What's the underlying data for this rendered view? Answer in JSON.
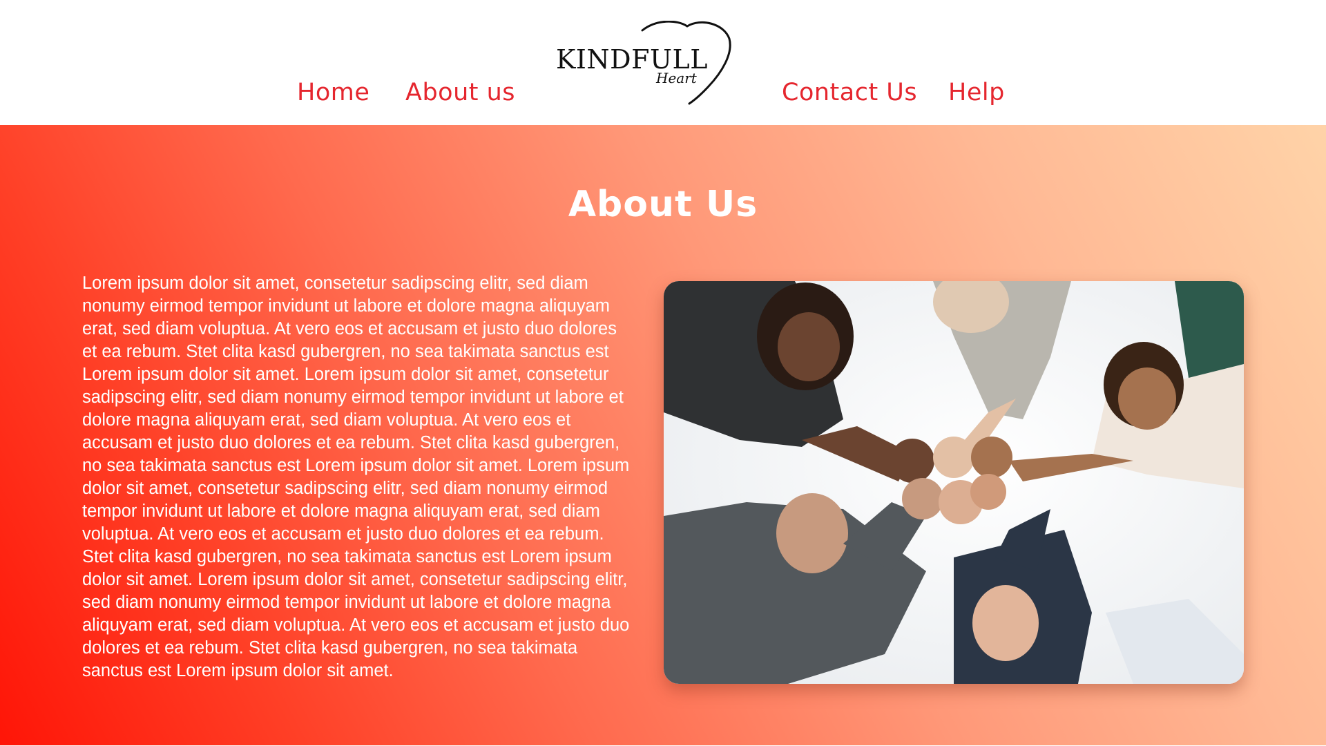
{
  "nav": {
    "home": "Home",
    "about": "About us",
    "contact": "Contact Us",
    "help": "Help"
  },
  "logo": {
    "main": "KINDFULL",
    "sub": "Heart",
    "icon": "heart-outline-icon"
  },
  "hero": {
    "title": "About Us",
    "body": "Lorem ipsum dolor sit amet, consetetur sadipscing elitr, sed diam nonumy eirmod tempor invidunt ut labore et dolore magna aliquyam erat, sed diam voluptua. At vero eos et accusam et justo duo dolores et ea rebum. Stet clita kasd gubergren, no sea takimata sanctus est Lorem ipsum dolor sit amet. Lorem ipsum dolor sit amet, consetetur sadipscing elitr, sed diam nonumy eirmod tempor invidunt ut labore et dolore magna aliquyam erat, sed diam voluptua. At vero eos et accusam et justo duo dolores et ea rebum. Stet clita kasd gubergren, no sea takimata sanctus est Lorem ipsum dolor sit amet. Lorem ipsum dolor sit amet, consetetur sadipscing elitr, sed diam nonumy eirmod tempor invidunt ut labore et dolore magna aliquyam erat, sed diam voluptua. At vero eos et accusam et justo duo dolores et ea rebum. Stet clita kasd gubergren, no sea takimata sanctus est Lorem ipsum dolor sit amet. Lorem ipsum dolor sit amet, consetetur sadipscing elitr, sed diam nonumy eirmod tempor invidunt ut labore et dolore magna aliquyam erat, sed diam voluptua. At vero eos et accusam et justo duo dolores et ea rebum. Stet clita kasd gubergren, no sea takimata sanctus est Lorem ipsum dolor sit amet."
  },
  "colors": {
    "accent": "#e5262e",
    "gradient_start": "#ff1507",
    "gradient_end": "#ffd3a8",
    "header_bg": "#ffffff"
  }
}
